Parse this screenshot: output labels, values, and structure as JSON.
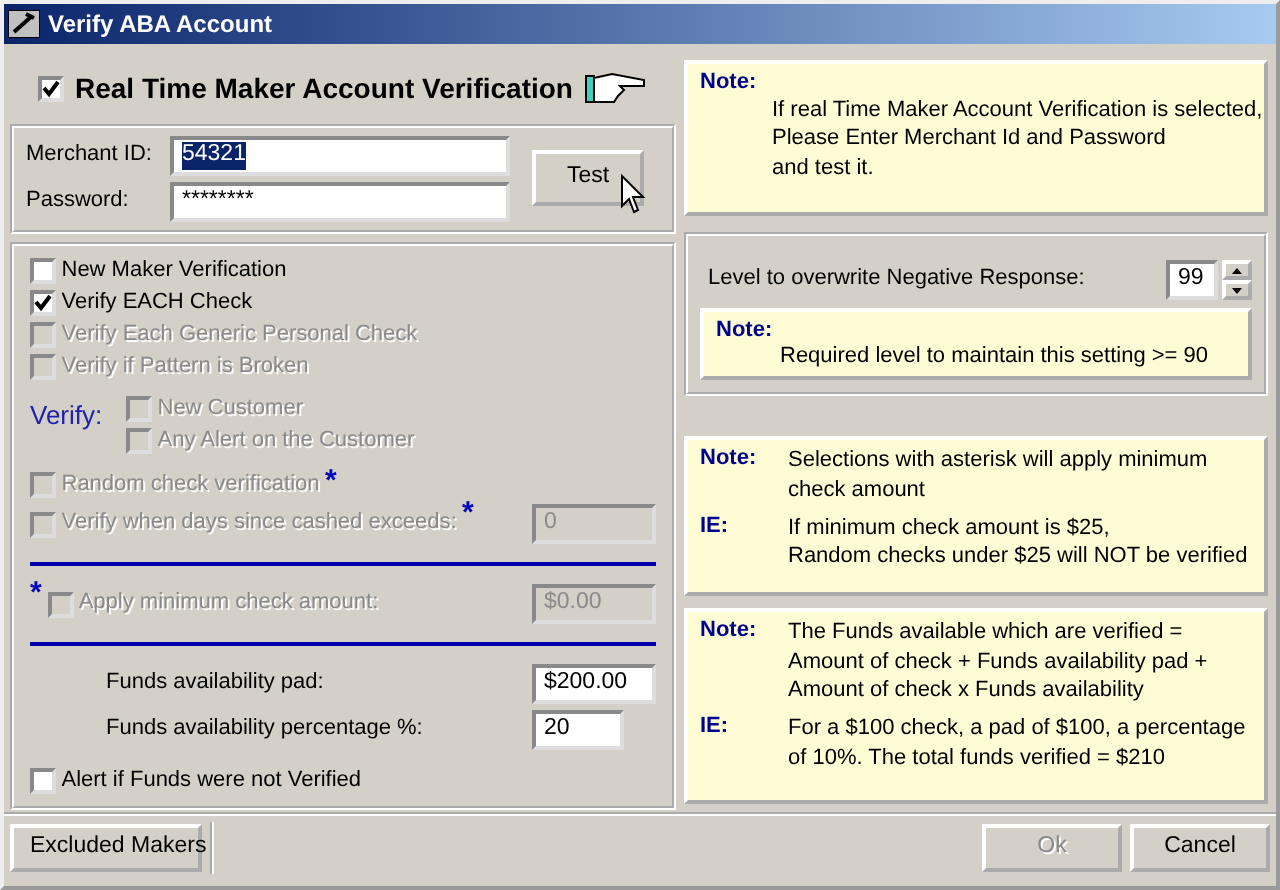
{
  "window": {
    "title": "Verify ABA Account"
  },
  "realtime": {
    "label": "Real Time Maker Account Verification",
    "checked": true
  },
  "merchant": {
    "fields": [
      {
        "label": "Merchant ID:",
        "value": "54321",
        "selected": true
      },
      {
        "label": "Password:",
        "value": "********",
        "selected": false
      }
    ],
    "test_button": "Test"
  },
  "options": [
    {
      "kind": "checkbox",
      "label": "New Maker Verification",
      "checked": false,
      "disabled": false
    },
    {
      "kind": "checkbox",
      "label": "Verify EACH Check",
      "checked": true,
      "disabled": false
    },
    {
      "kind": "checkbox",
      "label": "Verify Each Generic Personal Check",
      "checked": false,
      "disabled": true
    },
    {
      "kind": "checkbox",
      "label": "Verify if Pattern is Broken",
      "checked": false,
      "disabled": true
    },
    {
      "kind": "group",
      "label": "Verify:",
      "items": [
        {
          "label": "New Customer",
          "checked": false,
          "disabled": true
        },
        {
          "label": "Any Alert on the Customer",
          "checked": false,
          "disabled": true
        }
      ]
    },
    {
      "kind": "checkbox",
      "label": "Random check verification",
      "checked": false,
      "disabled": true,
      "asterisk": "*"
    },
    {
      "kind": "checkbox",
      "label": "Verify when days since cashed exceeds:",
      "checked": false,
      "disabled": true,
      "asterisk": "*",
      "field": {
        "value": "0",
        "disabled": true
      }
    },
    {
      "kind": "rule"
    },
    {
      "kind": "checkbox",
      "label": "Apply minimum check amount:",
      "checked": false,
      "disabled": true,
      "lead_asterisk": "*",
      "field": {
        "value": "$0.00",
        "disabled": true
      }
    },
    {
      "kind": "rule"
    },
    {
      "kind": "field",
      "label": "Funds availability pad:",
      "field": {
        "value": "$200.00",
        "disabled": false
      }
    },
    {
      "kind": "field",
      "label": "Funds availability percentage %:",
      "field": {
        "value": "20",
        "disabled": false
      }
    },
    {
      "kind": "checkbox",
      "label": "Alert if Funds were not Verified",
      "checked": false,
      "disabled": false
    }
  ],
  "panels": [
    {
      "kind": "note",
      "rows": [
        {
          "tag": "Note:",
          "lines": []
        },
        {
          "tag": "",
          "lines": [
            "If real Time Maker Account Verification is selected,",
            "Please Enter Merchant Id and Password",
            "and test it."
          ]
        }
      ]
    },
    {
      "kind": "level",
      "label": "Level to overwrite Negative Response:",
      "value": "99",
      "note": {
        "tag": "Note:",
        "lines": [
          "Required  level to maintain this setting >= 90"
        ]
      }
    },
    {
      "kind": "note",
      "rows": [
        {
          "tag": "Note:",
          "lines": [
            "Selections with asterisk will apply minimum",
            "check amount"
          ]
        },
        {
          "tag": "IE:",
          "lines": [
            "If minimum check amount is $25,",
            "Random checks under $25 will NOT be verified"
          ]
        }
      ]
    },
    {
      "kind": "note",
      "rows": [
        {
          "tag": "Note:",
          "lines": [
            "The Funds available which are  verified =",
            "Amount of check + Funds availability pad +",
            "Amount of check x Funds availability"
          ]
        },
        {
          "tag": "IE:",
          "lines": [
            "For a $100 check, a pad of $100, a percentage",
            "of 10%. The total funds verified = $210"
          ]
        }
      ]
    }
  ],
  "buttons": [
    {
      "label": "Excluded Makers",
      "disabled": false
    },
    {
      "label": "Ok",
      "disabled": true
    },
    {
      "label": "Cancel",
      "disabled": false
    }
  ]
}
